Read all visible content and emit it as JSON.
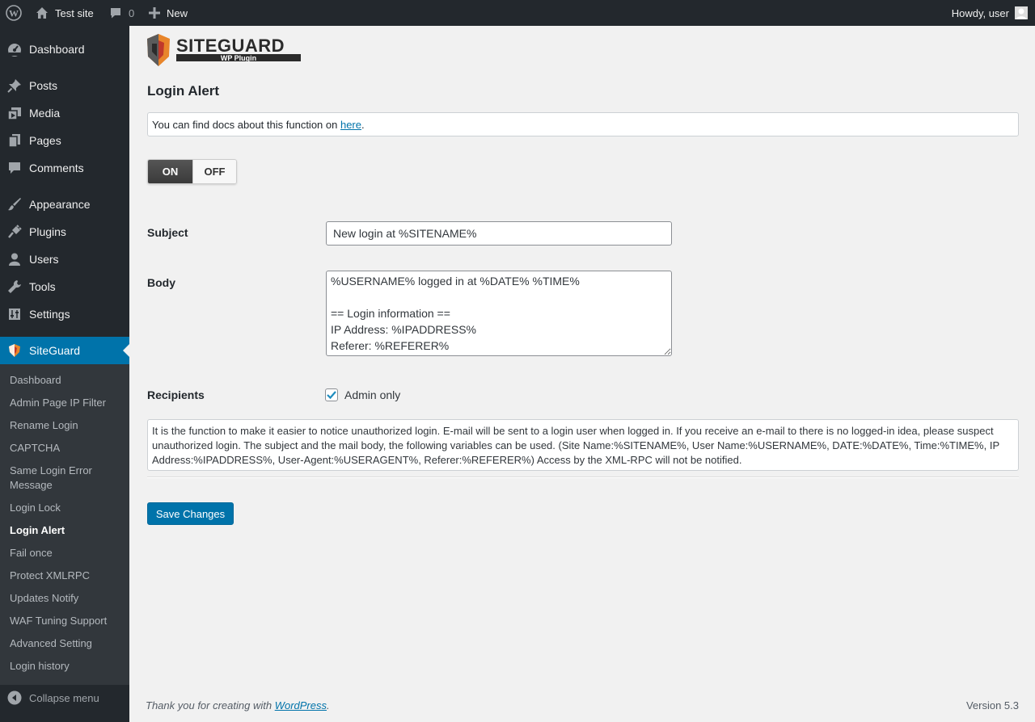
{
  "adminbar": {
    "site_name": "Test site",
    "comments_count": "0",
    "new_label": "New",
    "howdy": "Howdy, user"
  },
  "sidebar": {
    "items": [
      {
        "label": "Dashboard",
        "icon": "dashboard-icon"
      },
      {
        "label": "Posts",
        "icon": "pin-icon"
      },
      {
        "label": "Media",
        "icon": "media-icon"
      },
      {
        "label": "Pages",
        "icon": "pages-icon"
      },
      {
        "label": "Comments",
        "icon": "comment-icon"
      },
      {
        "label": "Appearance",
        "icon": "brush-icon"
      },
      {
        "label": "Plugins",
        "icon": "plug-icon"
      },
      {
        "label": "Users",
        "icon": "user-icon"
      },
      {
        "label": "Tools",
        "icon": "wrench-icon"
      },
      {
        "label": "Settings",
        "icon": "settings-icon"
      }
    ],
    "active": {
      "label": "SiteGuard",
      "icon": "siteguard-shield-icon",
      "accent": "#0073aa"
    },
    "submenu": [
      "Dashboard",
      "Admin Page IP Filter",
      "Rename Login",
      "CAPTCHA",
      "Same Login Error Message",
      "Login Lock",
      "Login Alert",
      "Fail once",
      "Protect XMLRPC",
      "Updates Notify",
      "WAF Tuning Support",
      "Advanced Setting",
      "Login history"
    ],
    "current_submenu": "Login Alert",
    "collapse_label": "Collapse menu"
  },
  "logo": {
    "brand": "SITEGUARD",
    "sub": "WP Plugin"
  },
  "page": {
    "title": "Login Alert",
    "docs_prefix": "You can find docs about this function on ",
    "docs_link": "here",
    "docs_suffix": ".",
    "toggle": {
      "on_label": "ON",
      "off_label": "OFF",
      "state": "ON"
    },
    "subject_label": "Subject",
    "subject_value": "New login at %SITENAME%",
    "body_label": "Body",
    "body_value": "%USERNAME% logged in at %DATE% %TIME%\n\n== Login information ==\nIP Address: %IPADDRESS%\nReferer: %REFERER%",
    "recipients_label": "Recipients",
    "recipients_option": "Admin only",
    "recipients_checked": true,
    "description": "It is the function to make it easier to notice unauthorized login. E-mail will be sent to a login user when logged in. If you receive an e-mail to there is no logged-in idea, please suspect unauthorized login. The subject and the mail body, the following variables can be used. (Site Name:%SITENAME%, User Name:%USERNAME%, DATE:%DATE%, Time:%TIME%, IP Address:%IPADDRESS%, User-Agent:%USERAGENT%, Referer:%REFERER%) Access by the XML-RPC will not be notified.",
    "save_label": "Save Changes"
  },
  "footer": {
    "thanks_prefix": "Thank you for creating with ",
    "thanks_link": "WordPress",
    "thanks_suffix": ".",
    "version": "Version 5.3"
  }
}
